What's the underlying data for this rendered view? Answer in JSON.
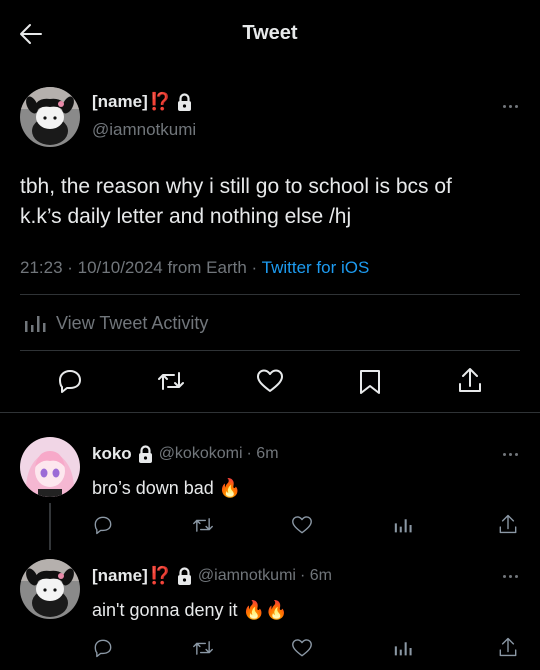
{
  "header": {
    "title": "Tweet"
  },
  "main_tweet": {
    "display_name": "[name]",
    "emoji_excl": "⁉️",
    "handle": "@iamnotkumi",
    "text_line1": "tbh, the reason why i still go to school is bcs of",
    "text_line2": "k.k’s daily letter and nothing else /hj",
    "timestamp": "21:23 · 10/10/2024 from Earth",
    "separator": " · ",
    "source": "Twitter for iOS",
    "activity_label": "View Tweet Activity"
  },
  "replies": [
    {
      "display_name": "koko",
      "handle": "@kokokomi",
      "time": "· 6m",
      "text": "bro’s down bad",
      "emoji": "🔥"
    },
    {
      "display_name": "[name]",
      "emoji_excl": "⁉️",
      "handle": "@iamnotkumi",
      "time": "· 6m",
      "text": "ain't gonna deny it",
      "emoji": "🔥🔥"
    }
  ],
  "colors": {
    "accent": "#1d9bf0",
    "background": "#000000",
    "muted": "#71767b"
  }
}
